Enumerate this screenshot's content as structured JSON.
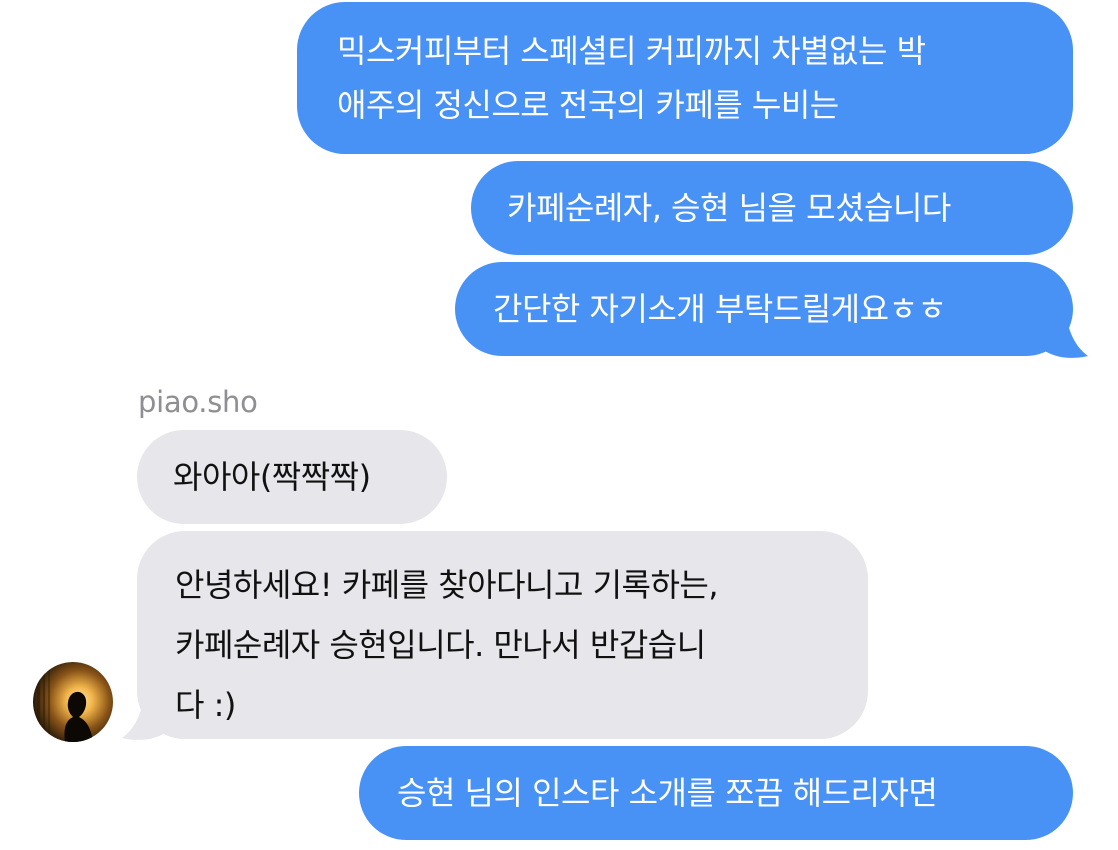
{
  "messages": {
    "out_1": [
      "믹스커피부터 스페셜티 커피까지 차별없는 박",
      "애주의 정신으로 전국의 카페를 누비는"
    ],
    "out_2": "카페순례자, 승현 님을 모셨습니다",
    "out_3": "간단한 자기소개 부탁드릴게요ㅎㅎ",
    "sender": "piao.sho",
    "in_1": "와아아(짝짝짝)",
    "in_2": [
      "안녕하세요! 카페를 찾아다니고 기록하는,",
      "카페순례자 승현입니다. 만나서 반갑습니",
      "다 :)"
    ],
    "out_4": "승현 님의 인스타 소개를 쪼끔 해드리자면"
  },
  "colors": {
    "outgoing_bubble": "#4891f5",
    "incoming_bubble": "#e6e6eb",
    "sender_name": "#8e8e93"
  },
  "icons": {
    "avatar": "silhouette-avatar"
  }
}
